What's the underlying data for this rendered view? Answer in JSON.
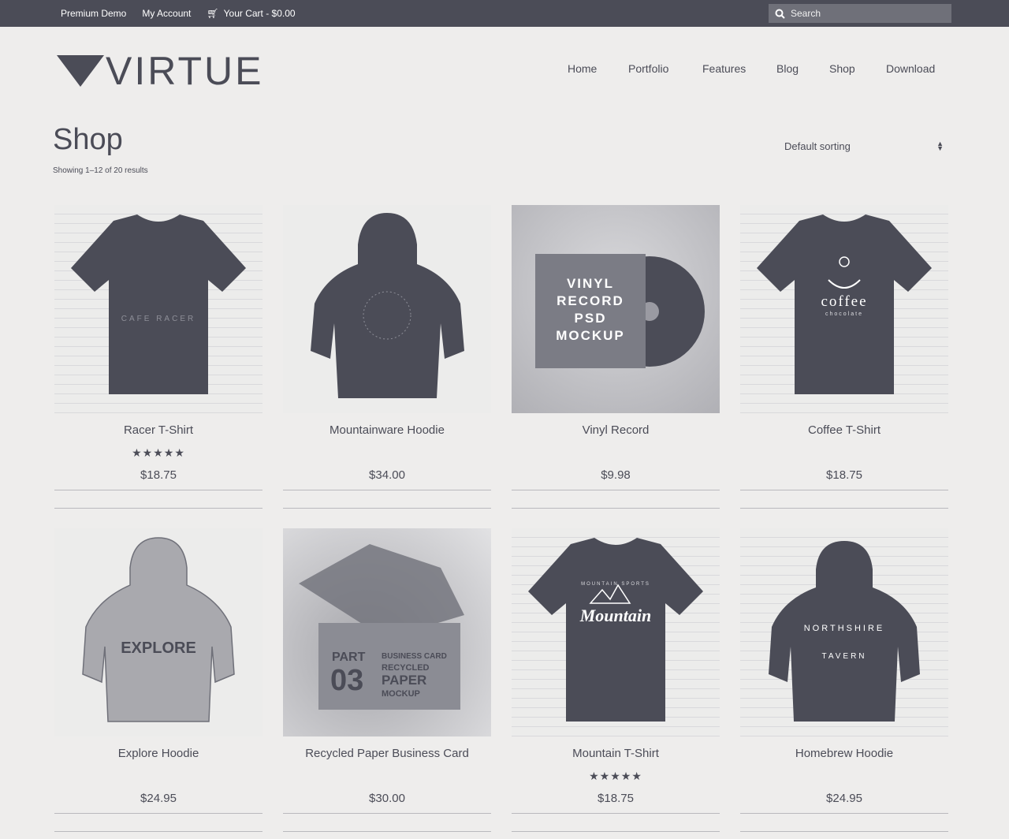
{
  "topbar": {
    "links": [
      "Premium Demo",
      "My Account"
    ],
    "cart": "Your Cart - $0.00",
    "search_placeholder": "Search"
  },
  "logo": {
    "text": "VIRTUE"
  },
  "nav": [
    "Home",
    "Portfolio",
    "Features",
    "Blog",
    "Shop",
    "Download"
  ],
  "shop": {
    "title": "Shop",
    "result_count": "Showing 1–12 of 20 results",
    "sort": "Default sorting"
  },
  "products": [
    {
      "name": "Racer T-Shirt",
      "price": "$18.75",
      "rating": "★★★★★",
      "rating_value": 5,
      "image_text": [
        "CAFE RACER"
      ]
    },
    {
      "name": "Mountainware Hoodie",
      "price": "$34.00",
      "rating": "",
      "image_text": []
    },
    {
      "name": "Vinyl Record",
      "price": "$9.98",
      "rating": "",
      "image_text": [
        "VINYL",
        "RECORD",
        "PSD",
        "MOCKUP"
      ]
    },
    {
      "name": "Coffee T-Shirt",
      "price": "$18.75",
      "rating": "",
      "image_text": [
        "coffee",
        "chocolate"
      ]
    },
    {
      "name": "Explore Hoodie",
      "price": "$24.95",
      "rating": "",
      "image_text": [
        "EXPLORE"
      ]
    },
    {
      "name": "Recycled Paper Business Card",
      "price": "$30.00",
      "rating": "",
      "image_text": [
        "PART",
        "03",
        "BUSINESS CARD",
        "RECYCLED",
        "PAPER",
        "MOCKUP"
      ]
    },
    {
      "name": "Mountain T-Shirt",
      "price": "$18.75",
      "rating": "★★★★★",
      "rating_value": 5,
      "image_text": [
        "MOUNTAIN SPORTS",
        "Mountain"
      ]
    },
    {
      "name": "Homebrew Hoodie",
      "price": "$24.95",
      "rating": "",
      "image_text": [
        "NORTHSHIRE",
        "TAVERN"
      ]
    }
  ],
  "colors": {
    "dark": "#4b4c57",
    "background": "#eeedec",
    "topbar": "#4b4c57"
  }
}
